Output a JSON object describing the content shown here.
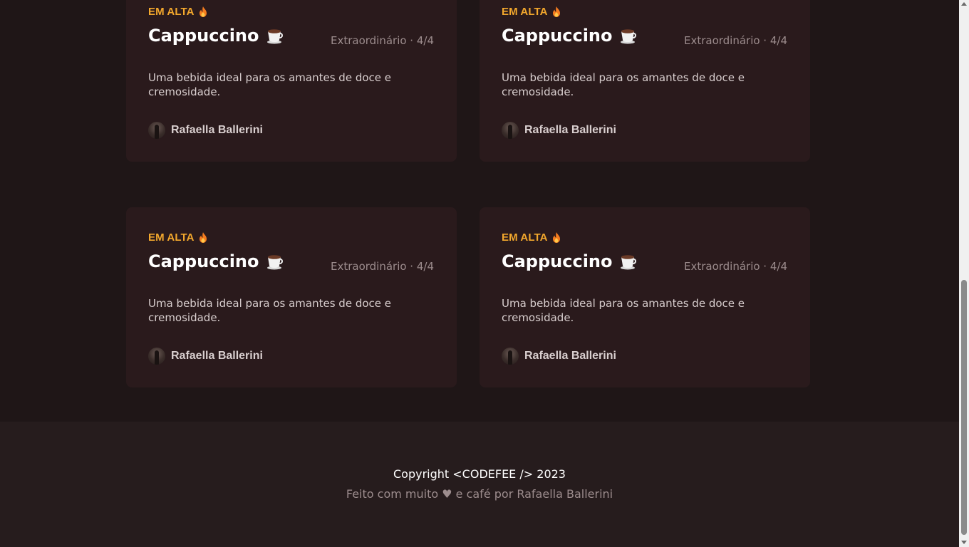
{
  "cards": [
    {
      "tag": "EM ALTA",
      "tag_icon": "fire-icon",
      "title": "Cappuccino",
      "title_icon": "coffee-cup-icon",
      "rating": "Extraordinário · 4/4",
      "description": "Uma bebida ideal para os amantes de doce e cremosidade.",
      "author": "Rafaella Ballerini"
    },
    {
      "tag": "EM ALTA",
      "tag_icon": "fire-icon",
      "title": "Cappuccino",
      "title_icon": "coffee-cup-icon",
      "rating": "Extraordinário · 4/4",
      "description": "Uma bebida ideal para os amantes de doce e cremosidade.",
      "author": "Rafaella Ballerini"
    },
    {
      "tag": "EM ALTA",
      "tag_icon": "fire-icon",
      "title": "Cappuccino",
      "title_icon": "coffee-cup-icon",
      "rating": "Extraordinário · 4/4",
      "description": "Uma bebida ideal para os amantes de doce e cremosidade.",
      "author": "Rafaella Ballerini"
    },
    {
      "tag": "EM ALTA",
      "tag_icon": "fire-icon",
      "title": "Cappuccino",
      "title_icon": "coffee-cup-icon",
      "rating": "Extraordinário · 4/4",
      "description": "Uma bebida ideal para os amantes de doce e cremosidade.",
      "author": "Rafaella Ballerini"
    }
  ],
  "footer": {
    "copyright": "Copyright <CODEFEE /> 2023",
    "made_with": "Feito com muito ♥ e café por Rafaella Ballerini"
  },
  "colors": {
    "page_background": "#1f1617",
    "card_background": "#2a1a1c",
    "footer_background": "#261c1d",
    "accent": "#f3a82d",
    "muted_text": "#9c8c8d"
  }
}
